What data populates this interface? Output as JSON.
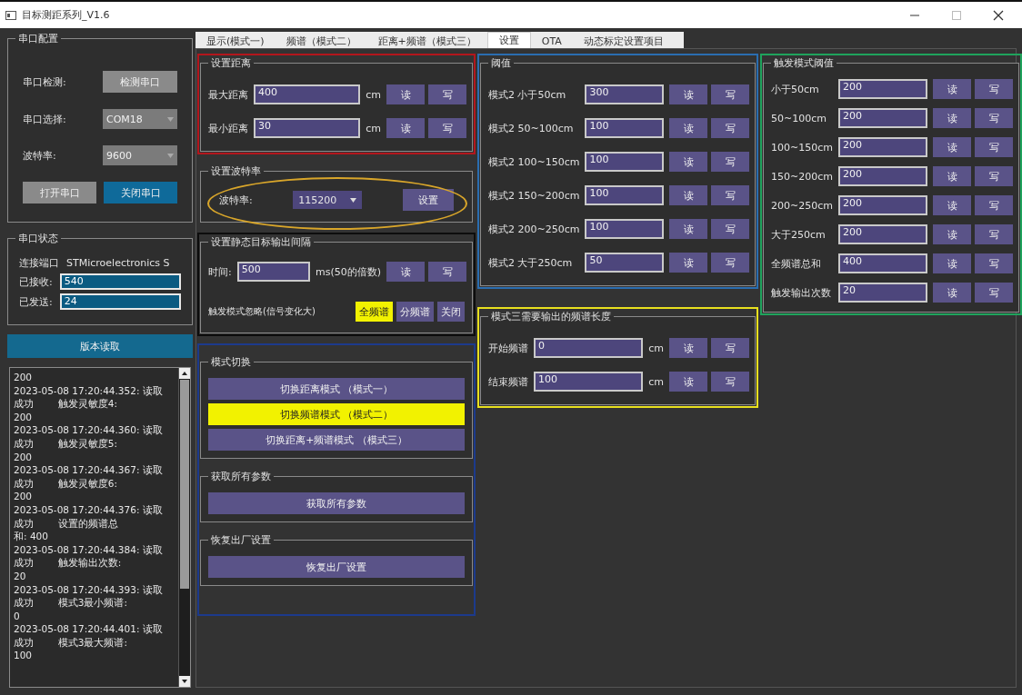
{
  "window": {
    "title": "目标测距系列_V1.6"
  },
  "serial_config": {
    "title": "串口配置",
    "detect_label": "串口检测:",
    "detect_button": "检测串口",
    "port_label": "串口选择:",
    "port_value": "COM18",
    "baud_label": "波特率:",
    "baud_value": "9600",
    "buttons": [
      {
        "label": "打开串口",
        "selected": false
      },
      {
        "label": "关闭串口",
        "selected": true
      }
    ]
  },
  "serial_status": {
    "title": "串口状态",
    "port_label": "连接端口",
    "port_name": "STMicroelectronics S",
    "received_label": "已接收:",
    "received": "540",
    "sent_label": "已发送:",
    "sent": "24"
  },
  "version_button": "版本读取",
  "log": {
    "lines": [
      "200",
      "2023-05-08 17:20:44.352: 读取",
      "成功        触发灵敏度4:",
      "200",
      "2023-05-08 17:20:44.360: 读取",
      "成功        触发灵敏度5:",
      "200",
      "2023-05-08 17:20:44.367: 读取",
      "成功        触发灵敏度6:",
      "200",
      "2023-05-08 17:20:44.376: 读取",
      "成功        设置的频谱总",
      "和: 400",
      "2023-05-08 17:20:44.384: 读取",
      "成功        触发输出次数:",
      "20",
      "2023-05-08 17:20:44.393: 读取",
      "成功        模式3最小频谱:",
      "0",
      "2023-05-08 17:20:44.401: 读取",
      "成功        模式3最大频谱:",
      "100"
    ]
  },
  "tabs": [
    {
      "label": "显示(模式一)",
      "selected": false
    },
    {
      "label": "频谱（模式二）",
      "selected": false
    },
    {
      "label": "距离+频谱（模式三）",
      "selected": false
    },
    {
      "label": "设置",
      "selected": true
    },
    {
      "label": "OTA",
      "selected": false
    },
    {
      "label": "动态标定设置项目",
      "selected": false
    }
  ],
  "columns": [
    {
      "groups": [
        {
          "kind": "fields",
          "title": "设置距离",
          "annotation": {
            "kind": "rect",
            "color": "#b3161c"
          },
          "rows": [
            {
              "label": "最大距离",
              "value": "400",
              "unit": "cm",
              "read": "读",
              "write": "写"
            },
            {
              "label": "最小距离",
              "value": "30",
              "unit": "cm",
              "read": "读",
              "write": "写"
            }
          ]
        },
        {
          "kind": "baud",
          "title": "设置波特率",
          "annotation": {
            "kind": "ellipse",
            "color": "#d9a62a"
          },
          "label": "波特率:",
          "value": "115200",
          "button": "设置"
        },
        {
          "kind": "interval",
          "title": "设置静态目标输出间隔",
          "annotation": {
            "kind": "rect",
            "color": "#0d0d0d"
          },
          "label": "时间:",
          "value": "500",
          "unit": "ms(50的倍数)",
          "read": "读",
          "write": "写",
          "trigger_label": "触发模式忽略(信号变化大)",
          "options": [
            {
              "label": "全频谱",
              "selected": true
            },
            {
              "label": "分频谱",
              "selected": false
            },
            {
              "label": "关闭",
              "selected": false
            }
          ]
        },
        {
          "kind": "frame",
          "annotation": {
            "kind": "rect",
            "color": "#1c3a8c"
          },
          "groups": [
            {
              "kind": "buttons",
              "title": "模式切换",
              "buttons": [
                {
                  "label": "切换距离模式 （模式一）",
                  "selected": false
                },
                {
                  "label": "切换频谱模式 （模式二）",
                  "selected": true
                },
                {
                  "label": "切换距离+频谱模式 （模式三）",
                  "selected": false
                }
              ]
            },
            {
              "kind": "buttons",
              "title": "获取所有参数",
              "buttons": [
                {
                  "label": "获取所有参数"
                }
              ]
            },
            {
              "kind": "buttons",
              "title": "恢复出厂设置",
              "buttons": [
                {
                  "label": "恢复出厂设置"
                }
              ]
            }
          ]
        }
      ]
    },
    {
      "groups": [
        {
          "kind": "fields",
          "title": "阈值",
          "annotation": {
            "kind": "rect",
            "color": "#2a6db0"
          },
          "rows": [
            {
              "label": "模式2 小于50cm",
              "value": "300",
              "read": "读",
              "write": "写"
            },
            {
              "label": "模式2 50~100cm",
              "value": "100",
              "read": "读",
              "write": "写"
            },
            {
              "label": "模式2 100~150cm",
              "value": "100",
              "read": "读",
              "write": "写"
            },
            {
              "label": "模式2 150~200cm",
              "value": "100",
              "read": "读",
              "write": "写"
            },
            {
              "label": "模式2 200~250cm",
              "value": "100",
              "read": "读",
              "write": "写"
            },
            {
              "label": "模式2 大于250cm",
              "value": "50",
              "read": "读",
              "write": "写"
            }
          ]
        },
        {
          "kind": "fields",
          "title": "模式三需要输出的频谱长度",
          "annotation": {
            "kind": "rect",
            "color": "#e8e01e"
          },
          "rows": [
            {
              "label": "开始频谱",
              "value": "0",
              "unit": "cm",
              "read": "读",
              "write": "写"
            },
            {
              "label": "结束频谱",
              "value": "100",
              "unit": "cm",
              "read": "读",
              "write": "写"
            }
          ]
        }
      ]
    },
    {
      "groups": [
        {
          "kind": "fields",
          "title": "触发模式阈值",
          "annotation": {
            "kind": "rect",
            "color": "#1fa35c"
          },
          "rows": [
            {
              "label": "小于50cm",
              "value": "200",
              "read": "读",
              "write": "写"
            },
            {
              "label": "50~100cm",
              "value": "200",
              "read": "读",
              "write": "写"
            },
            {
              "label": "100~150cm",
              "value": "200",
              "read": "读",
              "write": "写"
            },
            {
              "label": "150~200cm",
              "value": "200",
              "read": "读",
              "write": "写"
            },
            {
              "label": "200~250cm",
              "value": "200",
              "read": "读",
              "write": "写"
            },
            {
              "label": "大于250cm",
              "value": "200",
              "read": "读",
              "write": "写"
            },
            {
              "label": "全频谱总和",
              "value": "400",
              "read": "读",
              "write": "写"
            },
            {
              "label": "触发输出次数",
              "value": "20",
              "read": "读",
              "write": "写"
            }
          ]
        }
      ]
    }
  ]
}
